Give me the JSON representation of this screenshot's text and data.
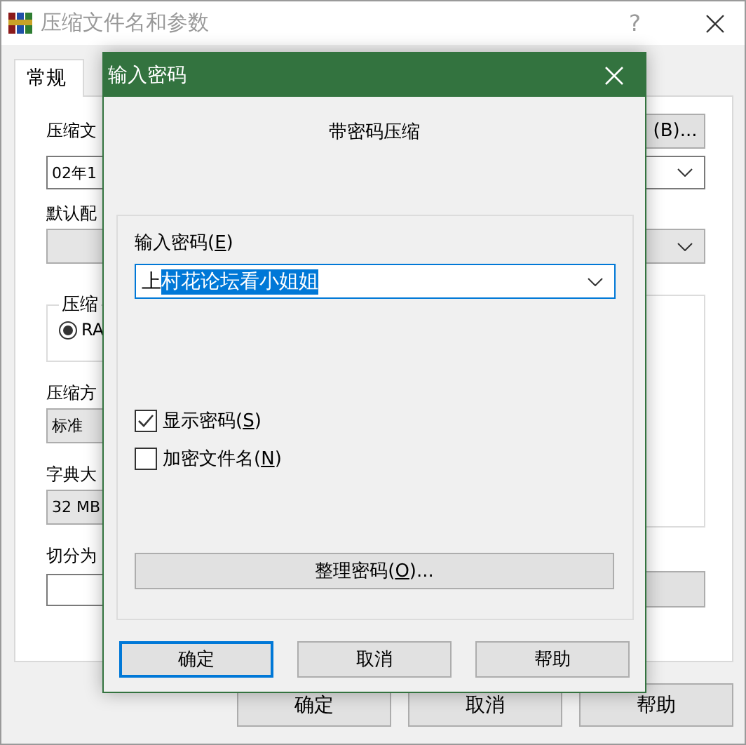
{
  "window": {
    "title": "压缩文件名和参数",
    "help_button": "?"
  },
  "tabs": [
    {
      "label": "常规",
      "selected": true
    }
  ],
  "general": {
    "archive_name_label": "压缩文",
    "browse_button": "(B)...",
    "archive_name": "02年1",
    "profile_label": "默认配",
    "format_group": "压缩",
    "format_options": [
      {
        "label": "RA",
        "selected": true
      }
    ],
    "method_label": "压缩方",
    "method": "标准",
    "dictionary_label": "字典大",
    "dictionary": "32 MB",
    "split_label": "切分为"
  },
  "buttons": [
    "确定",
    "取消",
    "帮助"
  ],
  "password_dialog": {
    "title": "输入密码",
    "heading": "带密码压缩",
    "field_label": {
      "label": "输入密码(",
      "key": "E",
      "suffix": ")"
    },
    "value_parts": [
      {
        "text": "上",
        "selected": false
      },
      {
        "text": "村花论坛看小姐姐",
        "selected": true
      }
    ],
    "checkboxes": [
      {
        "label": "显示密码(",
        "key": "S",
        "suffix": ")",
        "checked": true
      },
      {
        "label": "加密文件名(",
        "key": "N",
        "suffix": ")",
        "checked": false
      }
    ],
    "organize_button": {
      "label": "整理密码(",
      "key": "O",
      "suffix": ")..."
    },
    "buttons": [
      {
        "label": "确定",
        "default": true
      },
      {
        "label": "取消",
        "default": false
      },
      {
        "label": "帮助",
        "default": false
      }
    ]
  }
}
